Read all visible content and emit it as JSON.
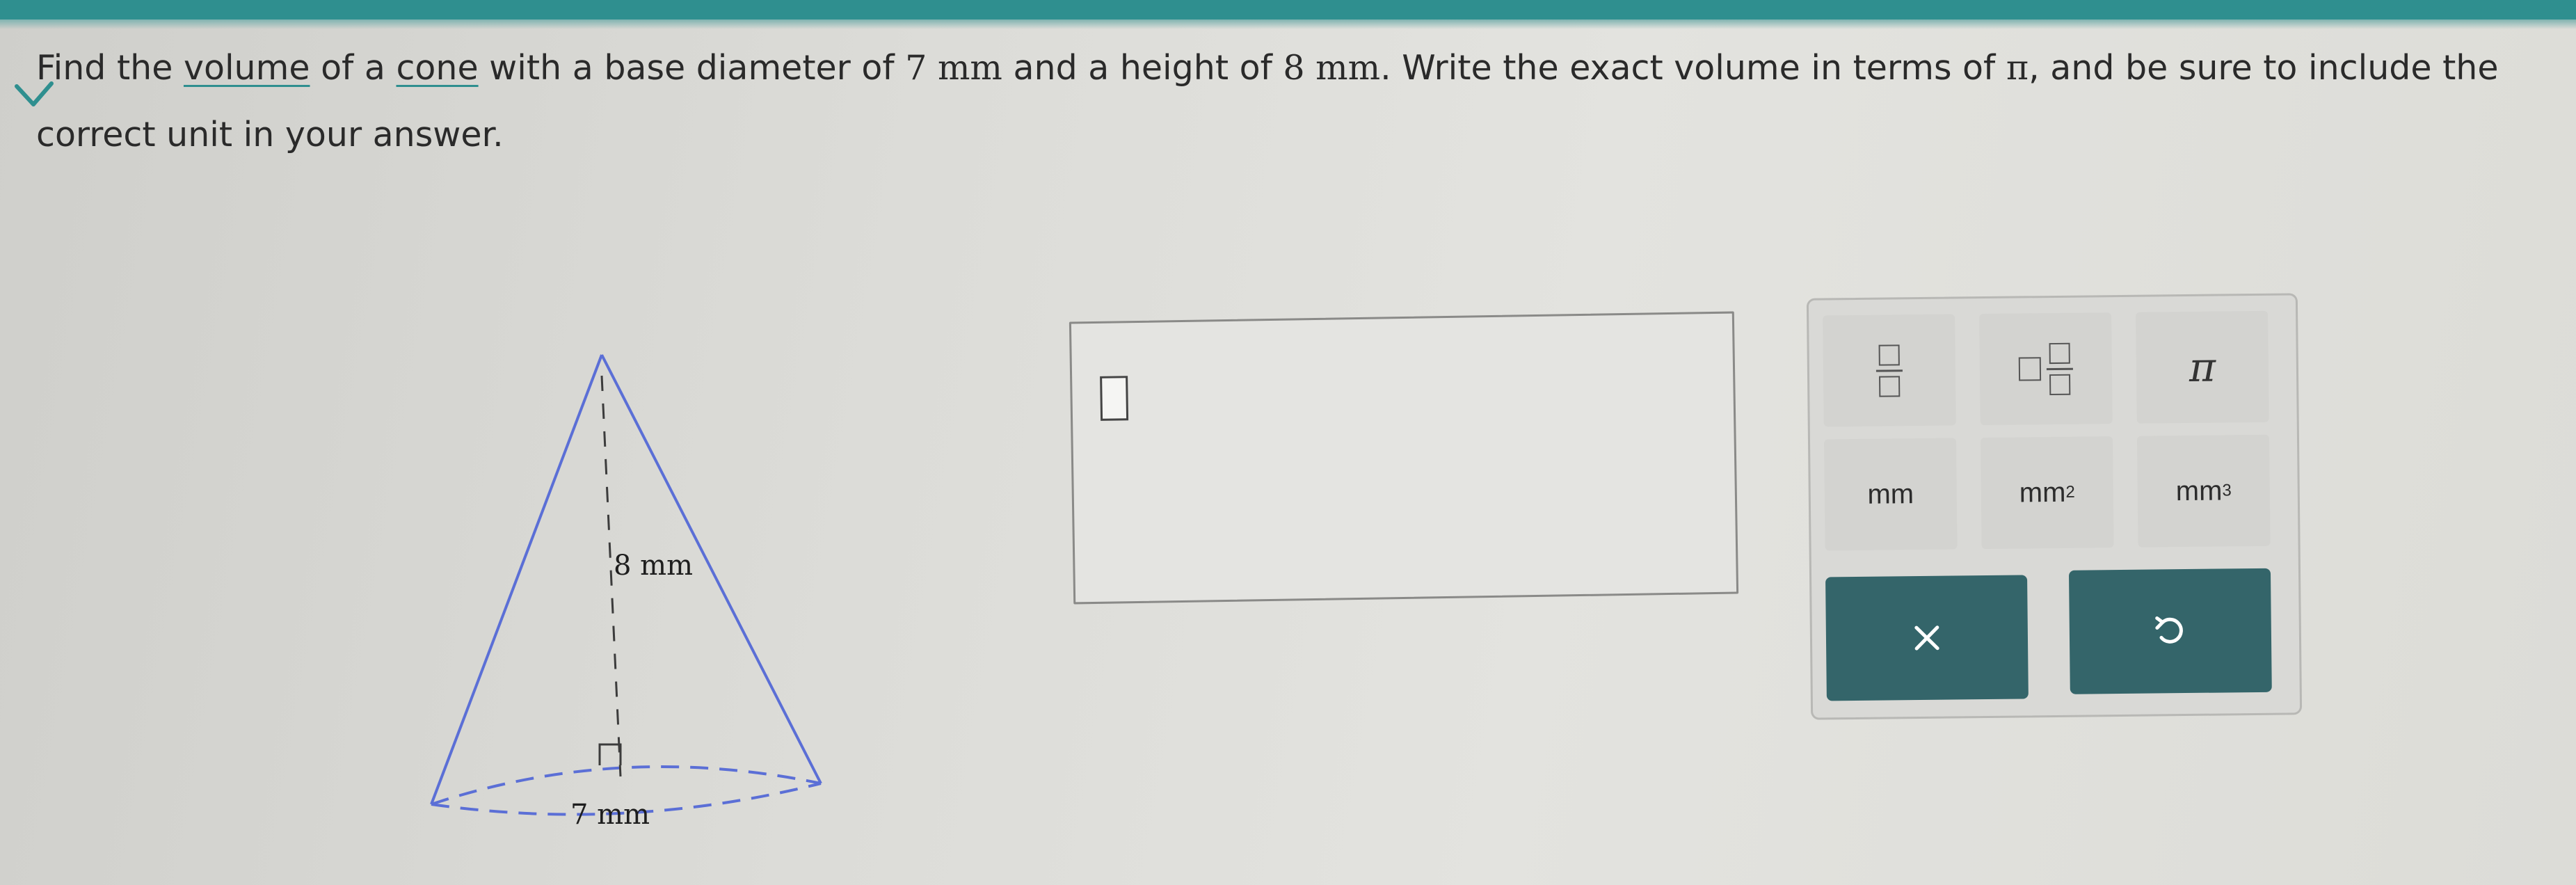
{
  "question": {
    "part1": "Find the ",
    "volume_link": "volume",
    "part2": " of a ",
    "cone_link": "cone",
    "part3": " with a base diameter of ",
    "diameter": "7 mm",
    "part4": " and a height of ",
    "height": "8 mm",
    "part5": ". Write the exact volume in terms of ",
    "pi": "π",
    "part6": ", and be sure to include the correct unit in your answer."
  },
  "figure": {
    "height_label": "8 mm",
    "diameter_label": "7 mm"
  },
  "keypad": {
    "fraction_key": "fraction",
    "mixed_number_key": "mixed number",
    "pi_key": "π",
    "unit_mm": "mm",
    "unit_mm2_base": "mm",
    "unit_mm2_exp": "2",
    "unit_mm3_base": "mm",
    "unit_mm3_exp": "3",
    "clear_icon": "x-icon",
    "undo_icon": "undo-icon"
  },
  "colors": {
    "header": "#2f8f8f",
    "accent": "#2f8f8f",
    "button": "#34656a",
    "cone_lines": "#5b6fd6"
  }
}
